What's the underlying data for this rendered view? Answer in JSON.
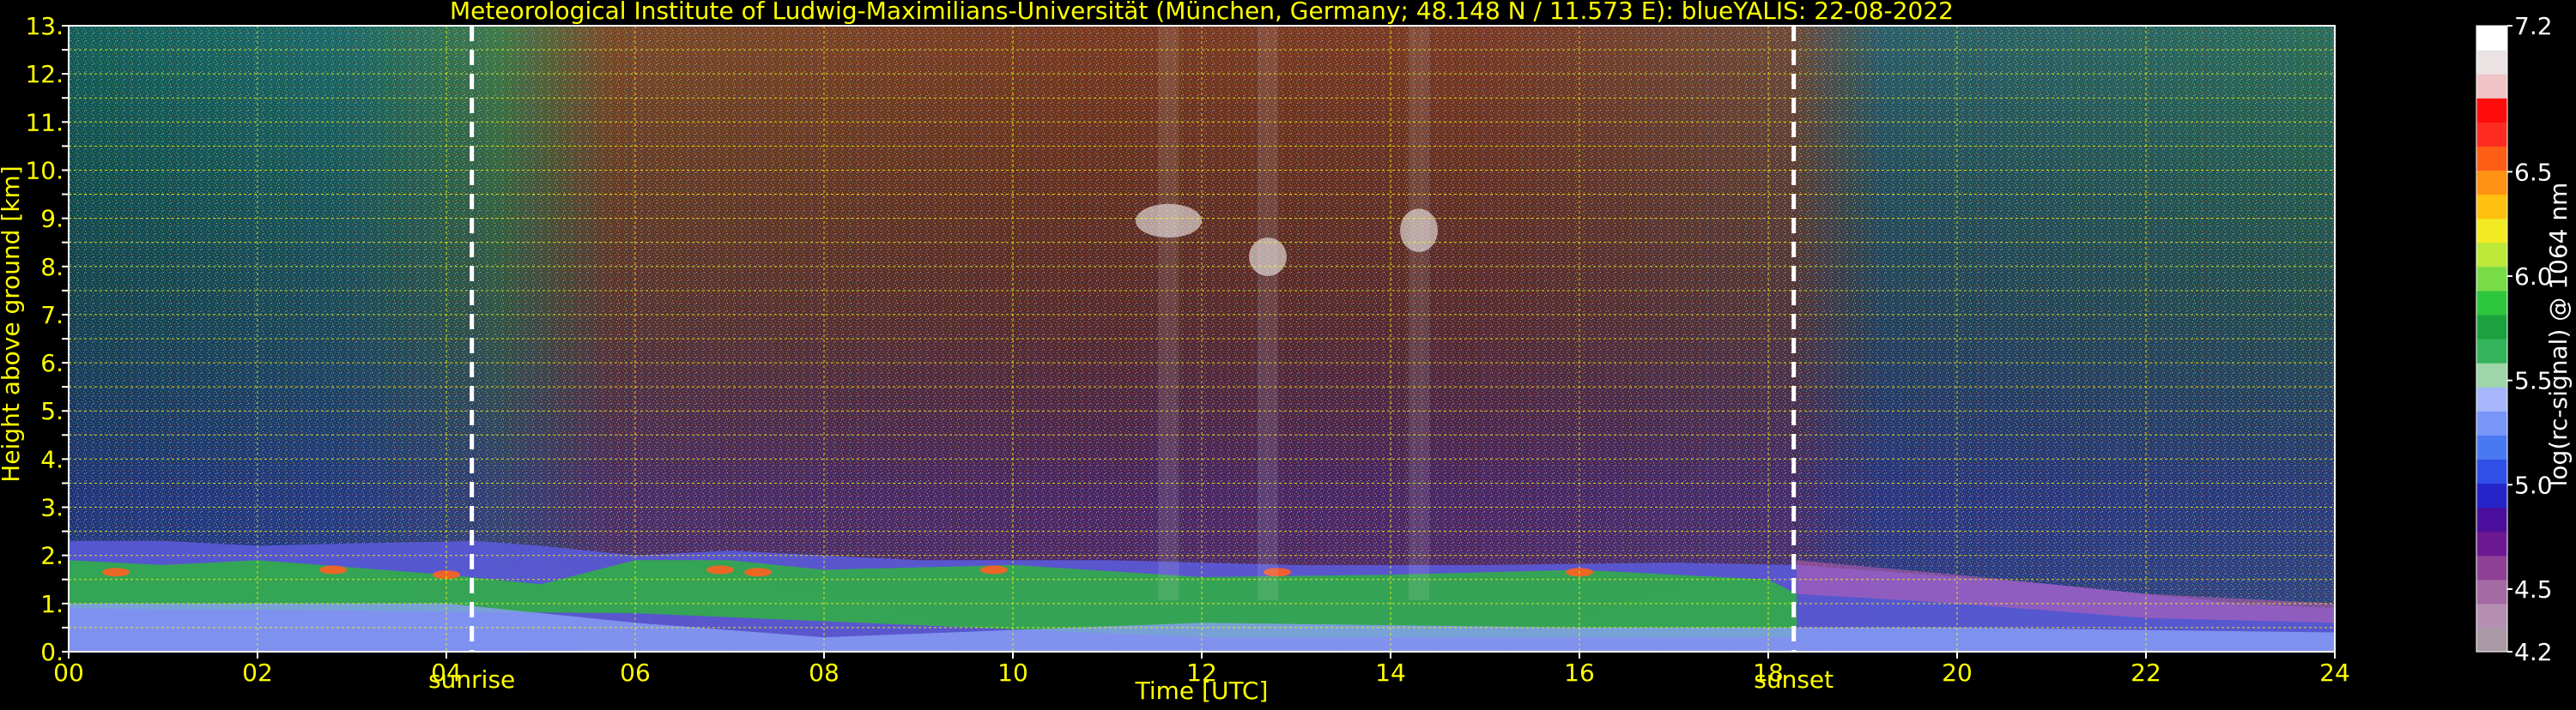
{
  "chart_data": {
    "type": "heatmap",
    "title": "Meteorological Institute of Ludwig-Maximilians-Universität (München, Germany; 48.148 N / 11.573 E):    blueYALIS: 22-08-2022",
    "xlabel": "Time [UTC]",
    "ylabel": "Height above ground [km]",
    "xlim": [
      0,
      24
    ],
    "ylim": [
      0,
      13
    ],
    "x_ticks": [
      "00",
      "02",
      "04",
      "06",
      "08",
      "10",
      "12",
      "14",
      "16",
      "18",
      "20",
      "22",
      "24"
    ],
    "x_tick_values": [
      0,
      2,
      4,
      6,
      8,
      10,
      12,
      14,
      16,
      18,
      20,
      22,
      24
    ],
    "y_ticks": [
      "0.",
      "0.5",
      "1.",
      "1.5",
      "2.",
      "2.5",
      "3.",
      "3.5",
      "4.",
      "4.5",
      "5.",
      "5.5",
      "6.",
      "6.5",
      "7.",
      "7.5",
      "8.",
      "8.5",
      "9.",
      "9.5",
      "10.",
      "10.5",
      "11.",
      "11.5",
      "12.",
      "12.5",
      "13."
    ],
    "y_tick_values": [
      0,
      0.5,
      1,
      1.5,
      2,
      2.5,
      3,
      3.5,
      4,
      4.5,
      5,
      5.5,
      6,
      6.5,
      7,
      7.5,
      8,
      8.5,
      9,
      9.5,
      10,
      10.5,
      11,
      11.5,
      12,
      12.5,
      13
    ],
    "grid": true,
    "colorbar": {
      "label": "log(rc-signal) @ 1064 nm",
      "range": [
        4.2,
        7.2
      ],
      "ticks": [
        "4.2",
        "4.5",
        "5.0",
        "5.5",
        "6.0",
        "6.5",
        "7.2"
      ],
      "tick_values": [
        4.2,
        4.5,
        5.0,
        5.5,
        6.0,
        6.5,
        7.2
      ],
      "colors": [
        "#a899a5",
        "#b58fb2",
        "#a36aa3",
        "#8e3f96",
        "#6c1891",
        "#4a0f9c",
        "#2424c8",
        "#2f4fe6",
        "#4a78f2",
        "#7896f8",
        "#a6b6fa",
        "#9ed6a8",
        "#33b35a",
        "#1ca13f",
        "#2ec63d",
        "#78dc46",
        "#bce83a",
        "#f2ea22",
        "#ffc010",
        "#ff9212",
        "#ff5e17",
        "#ff2c22",
        "#ff0c0c",
        "#f0c4c6",
        "#ebe3e3",
        "#ffffff"
      ]
    },
    "markers": [
      {
        "label": "sunrise",
        "x": 4.27
      },
      {
        "label": "sunset",
        "x": 18.27
      }
    ],
    "features": {
      "boundary_layer_top_km": 2.0,
      "cirrus": [
        {
          "time_start": 11.3,
          "time_end": 12.0,
          "height_km": [
            8.6,
            9.3
          ]
        },
        {
          "time_start": 12.5,
          "time_end": 12.9,
          "height_km": [
            7.8,
            8.6
          ]
        },
        {
          "time_start": 14.1,
          "time_end": 14.5,
          "height_km": [
            8.3,
            9.2
          ]
        }
      ]
    }
  }
}
